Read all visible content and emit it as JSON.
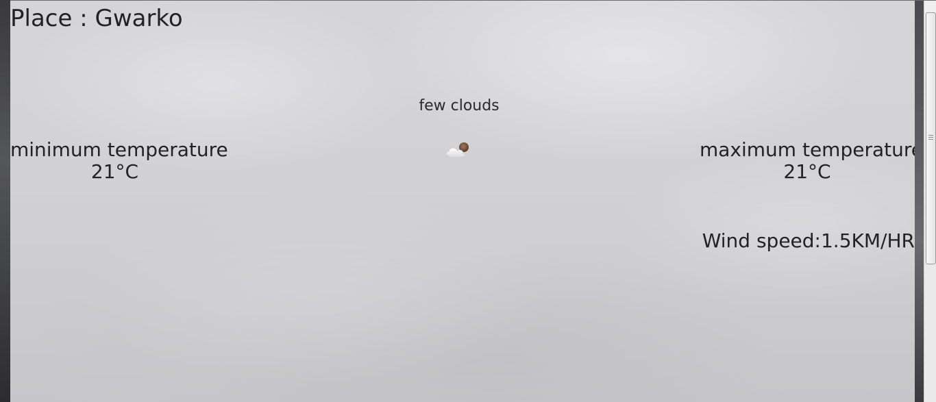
{
  "location": {
    "text": "Place : Gwarko"
  },
  "weather": {
    "description": "few clouds",
    "icon": "few-clouds-icon"
  },
  "min_temp": {
    "label": "minimum temperature",
    "value": "21°C"
  },
  "max_temp": {
    "label": "maximum temperature",
    "value": "21°C"
  },
  "wind": {
    "text": "Wind speed:1.5KM/HR"
  },
  "colors": {
    "text": "#222222",
    "background": "#d2d2d4"
  }
}
